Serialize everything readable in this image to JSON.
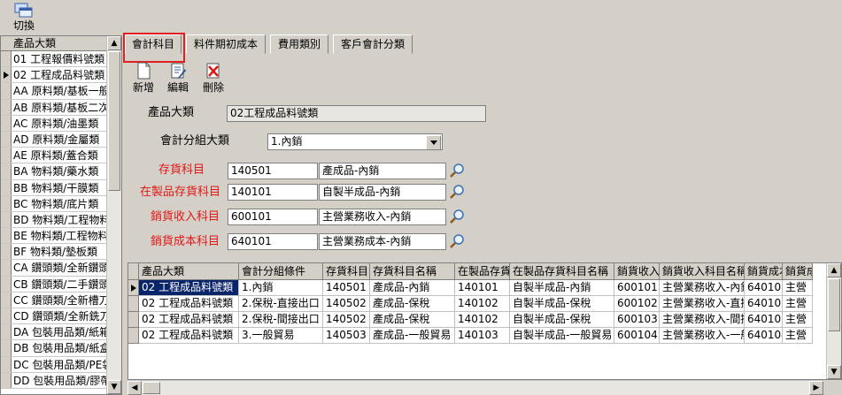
{
  "toolbar": {
    "switch_label": "切換"
  },
  "left_list": {
    "header": "產品大類",
    "items": [
      "01 工程報價料號類",
      "02 工程成品料號類",
      "AA 原料類/基板一般",
      "AB 原料類/基板二次",
      "AC 原料類/油墨類",
      "AD 原料類/金屬類",
      "AE 原料類/蓋合類",
      "BA 物料類/藥水類",
      "BB 物料類/干膜類",
      "BC 物料類/底片類",
      "BD 物料類/工程物料",
      "BE 物料類/工程物料",
      "BF 物料類/墊板類",
      "CA 鑽頭類/全新鑽頭",
      "CB 鑽頭類/二手鑽頭",
      "CC 鑽頭類/全新槽刀",
      "CD 鑽頭類/全新銑刀",
      "DA 包裝用品類/紙箱",
      "DB 包裝用品類/紙盒",
      "DC 包裝用品類/PE袋",
      "DD 包裝用品類/膠帶"
    ]
  },
  "tabs": [
    "會計科目",
    "料件期初成本",
    "費用類別",
    "客戶會計分類"
  ],
  "actions": {
    "add": "新增",
    "edit": "編輯",
    "delete": "刪除"
  },
  "form": {
    "product_category_label": "產品大類",
    "product_category_value": "02工程成品料號類",
    "acct_group_label": "會計分組大類",
    "acct_group_value": "1.內銷",
    "inventory_label": "存貨科目",
    "inventory_code": "140501",
    "inventory_name": "產成品-內銷",
    "wip_label": "在製品存貨科目",
    "wip_code": "140101",
    "wip_name": "自製半成品-內銷",
    "sales_label": "銷貨收入科目",
    "sales_code": "600101",
    "sales_name": "主營業務收入-內銷",
    "cost_label": "銷貨成本科目",
    "cost_code": "640101",
    "cost_name": "主營業務成本-內銷"
  },
  "grid": {
    "columns": [
      "產品大類",
      "會計分組條件",
      "存貨科目",
      "存貨科目名稱",
      "在製品存貨",
      "在製品存貨科目名稱",
      "銷貨收入",
      "銷貨收入科目名稱",
      "銷貨成本",
      "銷貨成"
    ],
    "rows": [
      [
        "02 工程成品料號類",
        "1.內銷",
        "140501",
        "產成品-內銷",
        "140101",
        "自製半成品-內銷",
        "600101",
        "主營業務收入-內銷",
        "640101",
        "主營"
      ],
      [
        "02 工程成品料號類",
        "2.保稅-直接出口",
        "140502",
        "產成品-保稅",
        "140102",
        "自製半成品-保稅",
        "600102",
        "主營業務收入-直接",
        "640102",
        "主營"
      ],
      [
        "02 工程成品料號類",
        "2.保稅-間接出口",
        "140502",
        "產成品-保稅",
        "140102",
        "自製半成品-保稅",
        "600103",
        "主營業務收入-間接",
        "640103",
        "主營"
      ],
      [
        "02 工程成品料號類",
        "3.一般貿易",
        "140503",
        "產成品-一般貿易",
        "140103",
        "自製半成品-一般貿易",
        "600104",
        "主營業務收入-一般",
        "640104",
        "主營"
      ]
    ]
  }
}
